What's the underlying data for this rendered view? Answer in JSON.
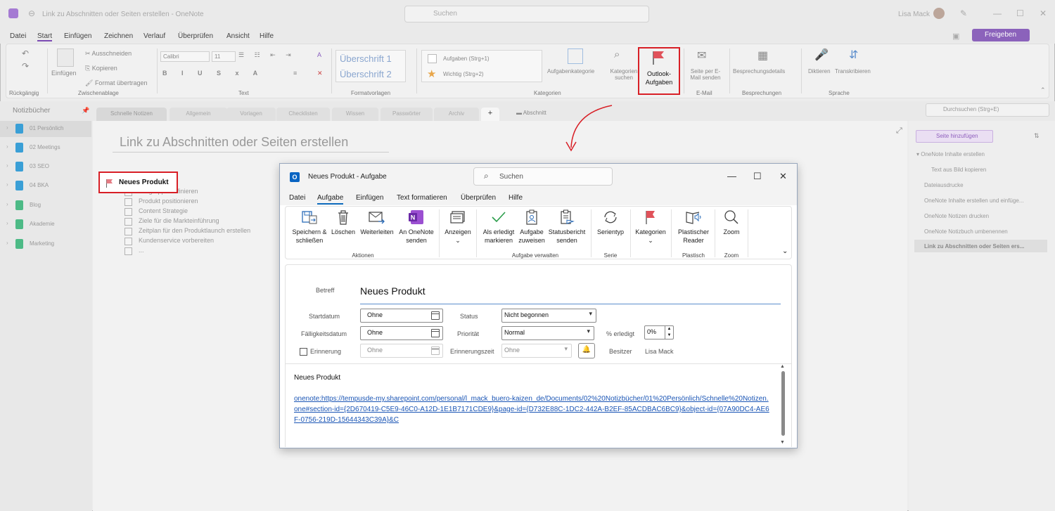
{
  "app": {
    "title": "Link zu Abschnitten oder Seiten erstellen - OneNote",
    "search_placeholder": "Suchen",
    "user": "Lisa Mack",
    "menu": [
      "Datei",
      "Start",
      "Einfügen",
      "Zeichnen",
      "Verlauf",
      "Überprüfen",
      "Ansicht",
      "Hilfe"
    ],
    "share_label": "Freigeben",
    "ribbon": {
      "undo_group": "Rückgängig",
      "clipboard": {
        "paste": "Einfügen",
        "cut": "Ausschneiden",
        "copy": "Kopieren",
        "format": "Format übertragen",
        "group": "Zwischenablage"
      },
      "font": {
        "name": "Calibri",
        "size": "11",
        "group": "Text"
      },
      "styles": {
        "h1": "Überschrift 1",
        "h2": "Überschrift 2",
        "group": "Formatvorlagen"
      },
      "tags": {
        "task": "Aufgaben (Strg+1)",
        "important": "Wichtig (Strg+2)",
        "task_category": "Aufgabenkategorie",
        "search_cat": "Kategorien suchen",
        "outlook": "Outlook-Aufgaben",
        "group": "Kategorien"
      },
      "email": {
        "send": "Seite per E-Mail senden",
        "group": "E-Mail"
      },
      "meetings": {
        "details": "Besprechungsdetails",
        "group": "Besprechungen"
      },
      "voice": {
        "dictate": "Diktieren",
        "transcribe": "Transkribieren",
        "group": "Sprache"
      }
    },
    "notebooks_header": "Notizbücher",
    "notebooks": [
      {
        "label": "01 Persönlich",
        "color": "#3a9fd6"
      },
      {
        "label": "02 Meetings",
        "color": "#3a9fd6"
      },
      {
        "label": "03 SEO",
        "color": "#3a9fd6"
      },
      {
        "label": "04 BKA",
        "color": "#3a9fd6"
      },
      {
        "label": "Blog",
        "color": "#4dba86"
      },
      {
        "label": "Akademie",
        "color": "#4dba86"
      },
      {
        "label": "Marketing",
        "color": "#4dba86"
      }
    ],
    "section_tabs": [
      "Schnelle Notizen",
      "Allgemein",
      "Vorlagen",
      "Checklisten",
      "Wissen",
      "Passwörter",
      "Archiv"
    ],
    "add_tab": "+",
    "section_label": "Abschnitt",
    "search_notes": "Durchsuchen (Strg+E)",
    "page_title": "Link zu Abschnitten oder Seiten erstellen",
    "note_heading": "Neues Produkt",
    "todos": [
      "Zielgruppe definieren",
      "Produkt positionieren",
      "Content Strategie",
      "Ziele für die Markteinführung",
      "Zeitplan für den Produktlaunch erstellen",
      "Kundenservice vorbereiten",
      "..."
    ],
    "add_page": "Seite hinzufügen",
    "pages": [
      "OneNote Inhalte erstellen",
      "Text aus Bild kopieren",
      "Dateiausdrucke",
      "OneNote Inhalte erstellen und einfüge...",
      "OneNote Notizen drucken",
      "OneNote Notizbuch umbenennen",
      "Link zu Abschnitten oder Seiten ers..."
    ]
  },
  "dialog": {
    "title": "Neues Produkt  -  Aufgabe",
    "search": "Suchen",
    "menu": [
      "Datei",
      "Aufgabe",
      "Einfügen",
      "Text formatieren",
      "Überprüfen",
      "Hilfe"
    ],
    "ribbon": {
      "save": "Speichern & schließen",
      "delete": "Löschen",
      "forward": "Weiterleiten",
      "onenote": "An OneNote senden",
      "show": "Anzeigen",
      "mark_done": "Als erledigt markieren",
      "assign": "Aufgabe zuweisen",
      "status_report": "Statusbericht senden",
      "recurrence": "Serientyp",
      "categorize": "Kategorien",
      "reader": "Plastischer Reader",
      "zoom": "Zoom",
      "groups": {
        "actions": "Aktionen",
        "manage": "Aufgabe verwalten",
        "series": "Serie",
        "reader": "Plastisch",
        "zoom": "Zoom"
      }
    },
    "form": {
      "subject_label": "Betreff",
      "subject": "Neues Produkt",
      "start_label": "Startdatum",
      "start": "Ohne",
      "due_label": "Fälligkeitsdatum",
      "due": "Ohne",
      "status_label": "Status",
      "status": "Nicht begonnen",
      "priority_label": "Priorität",
      "priority": "Normal",
      "percent_label": "% erledigt",
      "percent": "0%",
      "reminder_label": "Erinnerung",
      "reminder_date": "Ohne",
      "reminder_time_label": "Erinnerungszeit",
      "reminder_time": "Ohne",
      "owner_label": "Besitzer",
      "owner": "Lisa Mack"
    },
    "body": {
      "title": "Neues Produkt",
      "link": "onenote:https://tempusde-my.sharepoint.com/personal/l_mack_buero-kaizen_de/Documents/02%20Notizbücher/01%20Persönlich/Schnelle%20Notizen.one#section-id={2D670419-C5E9-46C0-A12D-1E1B7171CDE9}&page-id={D732E88C-1DC2-442A-B2EF-85ACDBAC6BC9}&object-id={07A90DC4-AE6F-0756-219D-15644343C39A}&C"
    }
  },
  "colors": {
    "accent": "#0f6cbd",
    "highlight": "#d81f26",
    "onenote_purple": "#7b4bb3"
  }
}
